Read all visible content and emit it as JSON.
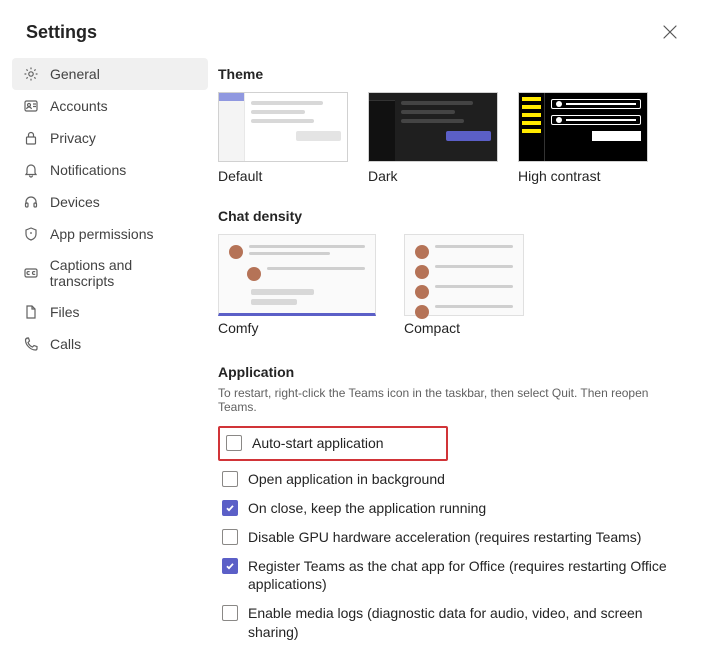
{
  "title": "Settings",
  "sidebar": {
    "items": [
      {
        "label": "General"
      },
      {
        "label": "Accounts"
      },
      {
        "label": "Privacy"
      },
      {
        "label": "Notifications"
      },
      {
        "label": "Devices"
      },
      {
        "label": "App permissions"
      },
      {
        "label": "Captions and transcripts"
      },
      {
        "label": "Files"
      },
      {
        "label": "Calls"
      }
    ]
  },
  "theme": {
    "title": "Theme",
    "options": [
      {
        "label": "Default"
      },
      {
        "label": "Dark"
      },
      {
        "label": "High contrast"
      }
    ]
  },
  "density": {
    "title": "Chat density",
    "options": [
      {
        "label": "Comfy"
      },
      {
        "label": "Compact"
      }
    ]
  },
  "application": {
    "title": "Application",
    "subtitle": "To restart, right-click the Teams icon in the taskbar, then select Quit. Then reopen Teams.",
    "options": [
      {
        "label": "Auto-start application",
        "checked": false,
        "highlight": true
      },
      {
        "label": "Open application in background",
        "checked": false
      },
      {
        "label": "On close, keep the application running",
        "checked": true
      },
      {
        "label": "Disable GPU hardware acceleration (requires restarting Teams)",
        "checked": false
      },
      {
        "label": "Register Teams as the chat app for Office (requires restarting Office applications)",
        "checked": true
      },
      {
        "label": "Enable media logs (diagnostic data for audio, video, and screen sharing)",
        "checked": false
      }
    ]
  }
}
